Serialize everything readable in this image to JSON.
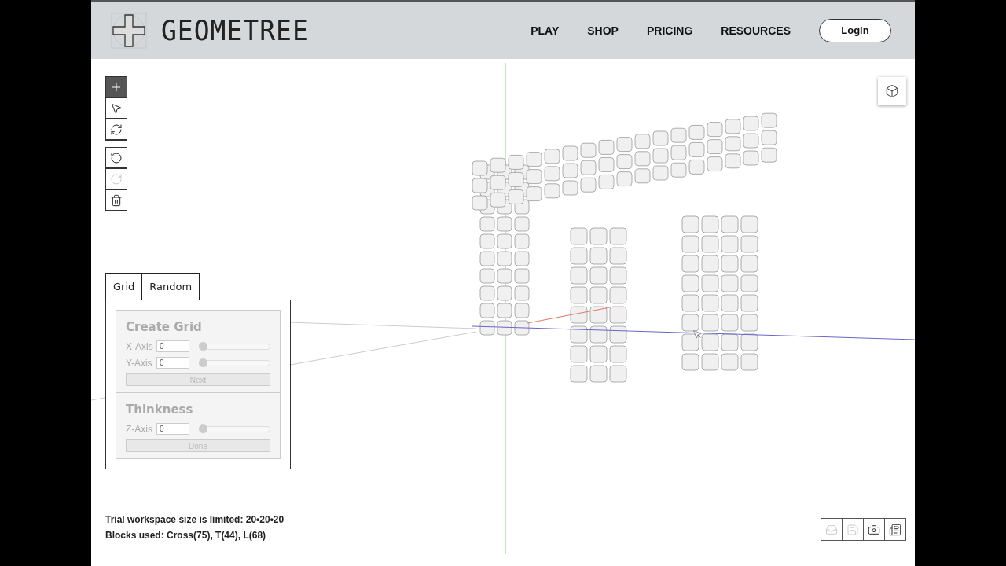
{
  "header": {
    "logo": "GEOMETREE",
    "nav": [
      "PLAY",
      "SHOP",
      "PRICING",
      "RESOURCES"
    ],
    "login": "Login"
  },
  "toolbar": [
    {
      "kind": "add",
      "selected": true,
      "disabled": false
    },
    {
      "kind": "select",
      "selected": false,
      "disabled": false
    },
    {
      "kind": "rotate",
      "selected": false,
      "disabled": false
    }
  ],
  "history": [
    {
      "kind": "undo",
      "disabled": false
    },
    {
      "kind": "redo",
      "disabled": true
    },
    {
      "kind": "delete",
      "disabled": false
    }
  ],
  "panel": {
    "tabs": [
      "Grid",
      "Random"
    ],
    "disabled": true,
    "sections": [
      {
        "title": "Create Grid",
        "fields": [
          {
            "label": "X-Axis",
            "value": "0",
            "level": 0
          },
          {
            "label": "Y-Axis",
            "value": "0",
            "level": 0
          }
        ],
        "button": "Next"
      },
      {
        "title": "Thinkness",
        "fields": [
          {
            "label": "Z-Axis",
            "value": "0",
            "level": 0
          }
        ],
        "button": "Done"
      }
    ]
  },
  "status": [
    "Trial workspace size is limited: 20•20•20",
    "Blocks used: Cross(75), T(44), L(68)"
  ],
  "file_actions": [
    {
      "kind": "inbox",
      "disabled": true
    },
    {
      "kind": "save",
      "disabled": true
    },
    {
      "kind": "camera",
      "disabled": false
    },
    {
      "kind": "document",
      "disabled": false
    }
  ]
}
